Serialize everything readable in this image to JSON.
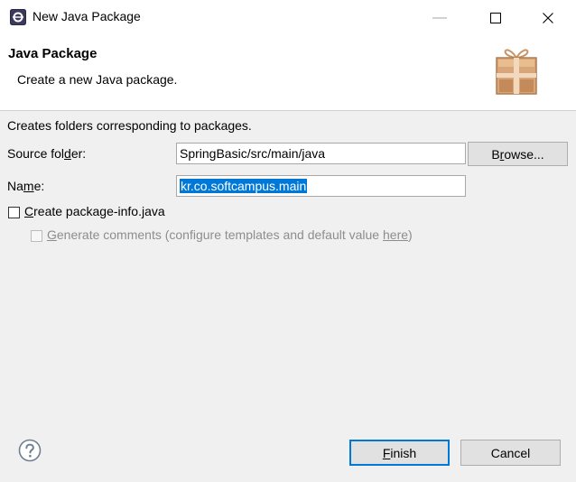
{
  "window": {
    "title": "New Java Package",
    "minimize_glyph": "—",
    "maximize_glyph": "☐",
    "close_glyph": "✕"
  },
  "header": {
    "title": "Java Package",
    "description": "Create a new Java package."
  },
  "body": {
    "description": "Creates folders corresponding to packages.",
    "source_folder": {
      "label_pre": "Source fol",
      "label_mnemonic": "d",
      "label_post": "er:",
      "value": "SpringBasic/src/main/java"
    },
    "browse_button": {
      "label_pre": "B",
      "label_mnemonic": "r",
      "label_post": "owse..."
    },
    "name": {
      "label_pre": "Na",
      "label_mnemonic": "m",
      "label_post": "e:",
      "value": "kr.co.softcampus.main"
    },
    "create_package_info": {
      "label_mnemonic": "C",
      "label_post": "reate package-info.java",
      "checked": false
    },
    "generate_comments": {
      "label_mnemonic": "G",
      "label_post": "enerate comments (configure templates and default value ",
      "link": "here",
      "label_end": ")",
      "checked": false,
      "enabled": false
    }
  },
  "footer": {
    "finish_button": {
      "label_mnemonic": "F",
      "label_post": "inish"
    },
    "cancel_button": {
      "label": "Cancel"
    }
  }
}
